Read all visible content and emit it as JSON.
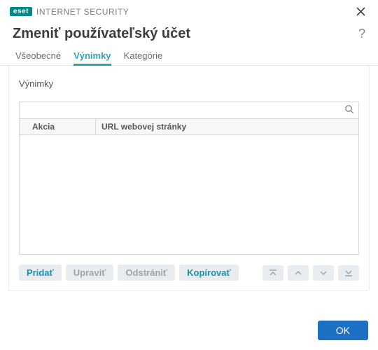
{
  "brand": {
    "logo": "eset",
    "product": "INTERNET SECURITY"
  },
  "page_title": "Zmeniť používateľský účet",
  "tabs": [
    {
      "id": "general",
      "label": "Všeobecné",
      "active": false
    },
    {
      "id": "exceptions",
      "label": "Výnimky",
      "active": true
    },
    {
      "id": "categories",
      "label": "Kategórie",
      "active": false
    }
  ],
  "section_label": "Výnimky",
  "table": {
    "columns": {
      "action": "Akcia",
      "url": "URL webovej stránky"
    },
    "rows": []
  },
  "search": {
    "value": "",
    "placeholder": ""
  },
  "buttons": {
    "add": "Pridať",
    "edit": "Upraviť",
    "delete": "Odstrániť",
    "copy": "Kopírovať",
    "ok": "OK"
  },
  "help_glyph": "?",
  "colors": {
    "accent": "#30a2b5",
    "primary_button": "#1d6fc4"
  }
}
